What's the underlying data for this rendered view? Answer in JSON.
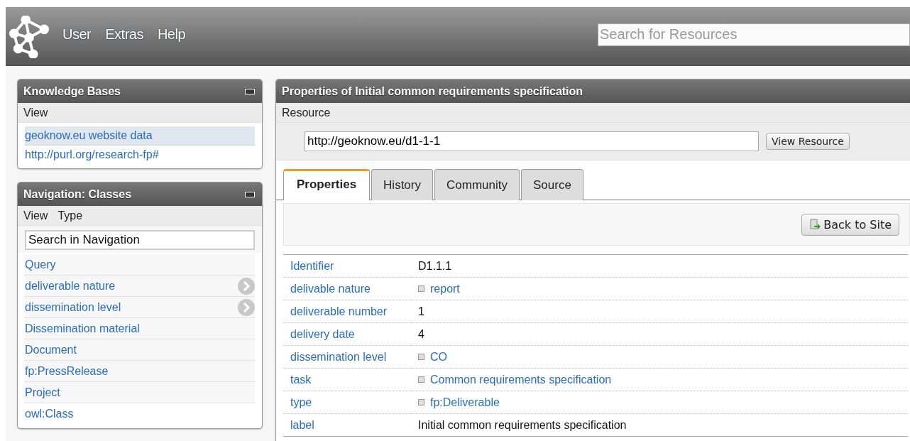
{
  "topbar": {
    "menu": [
      "User",
      "Extras",
      "Help"
    ],
    "search": {
      "placeholder": "Search for Resources"
    }
  },
  "knowledge_bases": {
    "title": "Knowledge Bases",
    "menu": [
      "View"
    ],
    "items": [
      {
        "label": "geoknow.eu website data",
        "selected": true
      },
      {
        "label": "http://purl.org/research-fp#",
        "selected": false
      }
    ]
  },
  "navigation": {
    "title": "Navigation: Classes",
    "menu": [
      "View",
      "Type"
    ],
    "search": {
      "value": "Search in Navigation"
    },
    "items": [
      {
        "label": "Query",
        "expandable": false
      },
      {
        "label": "deliverable nature",
        "expandable": true
      },
      {
        "label": "dissemination level",
        "expandable": true
      },
      {
        "label": "Dissemination material",
        "expandable": false
      },
      {
        "label": "Document",
        "expandable": false
      },
      {
        "label": "fp:PressRelease",
        "expandable": false
      },
      {
        "label": "Project",
        "expandable": false
      },
      {
        "label": "owl:Class",
        "expandable": false
      }
    ]
  },
  "properties": {
    "title": "Properties of Initial common requirements specification",
    "menu": [
      "Resource"
    ],
    "resource": {
      "value": "http://geoknow.eu/d1-1-1"
    },
    "view_button": "View Resource",
    "tabs": [
      {
        "label": "Properties",
        "selected": true
      },
      {
        "label": "History",
        "selected": false
      },
      {
        "label": "Community",
        "selected": false
      },
      {
        "label": "Source",
        "selected": false
      }
    ],
    "back_button": "Back to Site",
    "rows": [
      {
        "property": "Identifier",
        "value": "D1.1.1",
        "kind": "literal"
      },
      {
        "property": "delivable nature",
        "value": "report",
        "kind": "resource"
      },
      {
        "property": "deliverable number",
        "value": "1",
        "kind": "literal"
      },
      {
        "property": "delivery date",
        "value": "4",
        "kind": "literal"
      },
      {
        "property": "dissemination level",
        "value": "CO",
        "kind": "resource"
      },
      {
        "property": "task",
        "value": "Common requirements specification",
        "kind": "resource"
      },
      {
        "property": "type",
        "value": "fp:Deliverable",
        "kind": "resource"
      },
      {
        "property": "label",
        "value": "Initial common requirements specification",
        "kind": "plain"
      }
    ]
  }
}
